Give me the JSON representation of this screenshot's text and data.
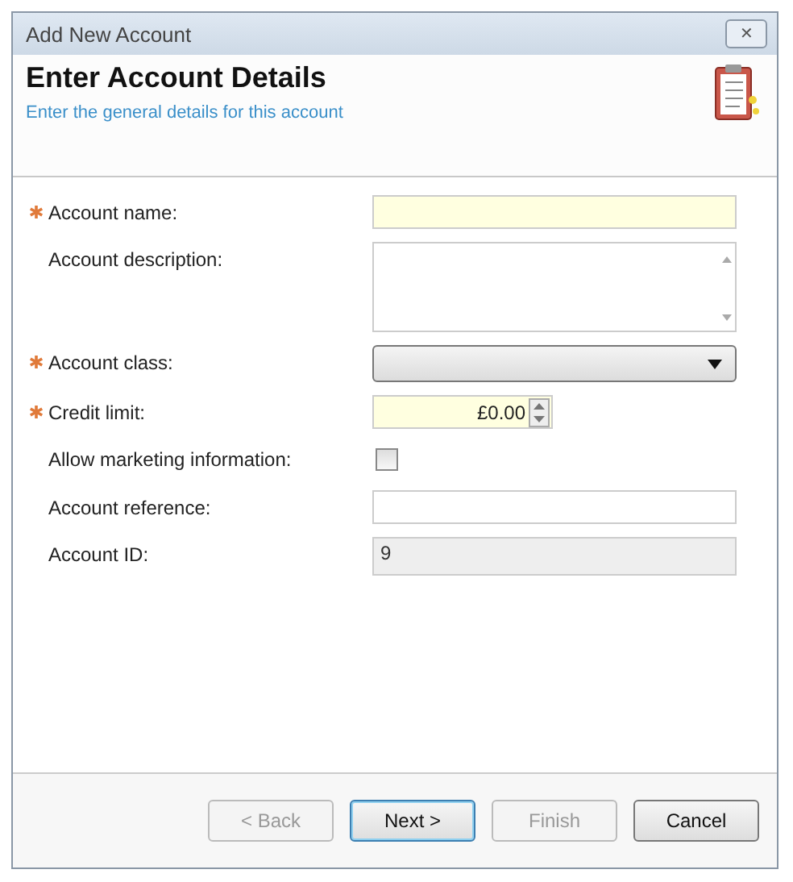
{
  "window": {
    "title": "Add New Account",
    "close": "✕"
  },
  "header": {
    "title": "Enter Account Details",
    "subtitle": "Enter the general details for this account"
  },
  "fields": [
    {
      "kind": "text",
      "label": "Account name:",
      "required": true
    },
    {
      "kind": "textarea",
      "label": "Account description:",
      "required": false
    },
    {
      "kind": "dropdown",
      "label": "Account class:",
      "required": true
    },
    {
      "kind": "currency",
      "label": "Credit limit:",
      "required": true,
      "value": "£0.00"
    },
    {
      "kind": "checkbox",
      "label": "Allow marketing information:",
      "required": false,
      "checked": false
    },
    {
      "kind": "text",
      "label": "Account reference:",
      "required": false
    },
    {
      "kind": "readonly",
      "label": "Account ID:",
      "required": false,
      "value": "9"
    }
  ],
  "buttons": [
    {
      "label": "< Back",
      "disabled": true,
      "default": false
    },
    {
      "label": "Next >",
      "disabled": false,
      "default": true
    },
    {
      "label": "Finish",
      "disabled": true,
      "default": false
    },
    {
      "label": "Cancel",
      "disabled": false,
      "default": false
    }
  ]
}
